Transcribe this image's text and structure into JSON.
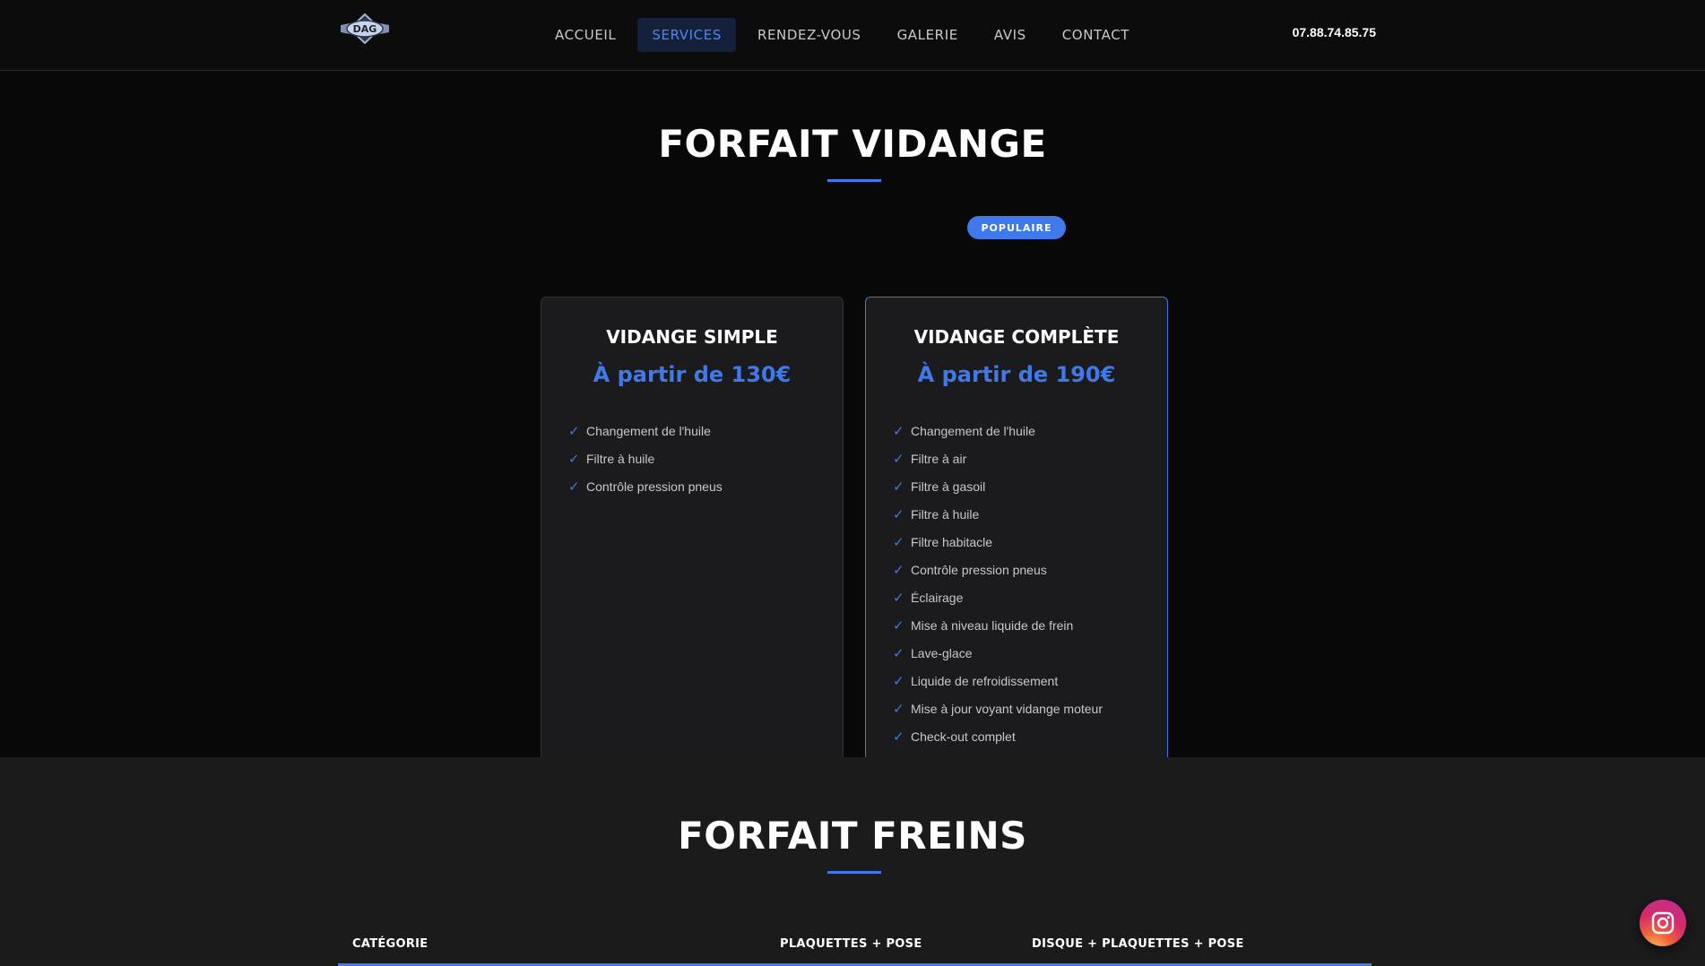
{
  "header": {
    "logo_text": "DAG",
    "nav": [
      {
        "label": "ACCUEIL",
        "active": false
      },
      {
        "label": "SERVICES",
        "active": true
      },
      {
        "label": "RENDEZ-VOUS",
        "active": false
      },
      {
        "label": "GALERIE",
        "active": false
      },
      {
        "label": "AVIS",
        "active": false
      },
      {
        "label": "CONTACT",
        "active": false
      }
    ],
    "phone": "07.88.74.85.75"
  },
  "vidange": {
    "title": "FORFAIT VIDANGE",
    "cards": [
      {
        "title": "VIDANGE SIMPLE",
        "price": "À partir de 130€",
        "features": [
          "Changement de l'huile",
          "Filtre à huile",
          "Contrôle pression pneus"
        ]
      },
      {
        "badge": "POPULAIRE",
        "title": "VIDANGE COMPLÈTE",
        "price": "À partir de 190€",
        "features": [
          "Changement de l'huile",
          "Filtre à air",
          "Filtre à gasoil",
          "Filtre à huile",
          "Filtre habitacle",
          "Contrôle pression pneus",
          "Éclairage",
          "Mise à niveau liquide de frein",
          "Lave-glace",
          "Liquide de refroidissement",
          "Mise à jour voyant vidange moteur",
          "Check-out complet"
        ]
      }
    ]
  },
  "freins": {
    "title": "FORFAIT FREINS",
    "columns": [
      "CATÉGORIE",
      "PLAQUETTES + POSE",
      "DISQUE + PLAQUETTES + POSE"
    ]
  },
  "icons": {
    "check": "check-icon",
    "instagram": "instagram-icon",
    "logo": "dag-logo-icon"
  },
  "colors": {
    "accent": "#3f79ea",
    "background": "#080808",
    "card": "#1b1b1d",
    "nav_active_bg": "#15203a"
  }
}
